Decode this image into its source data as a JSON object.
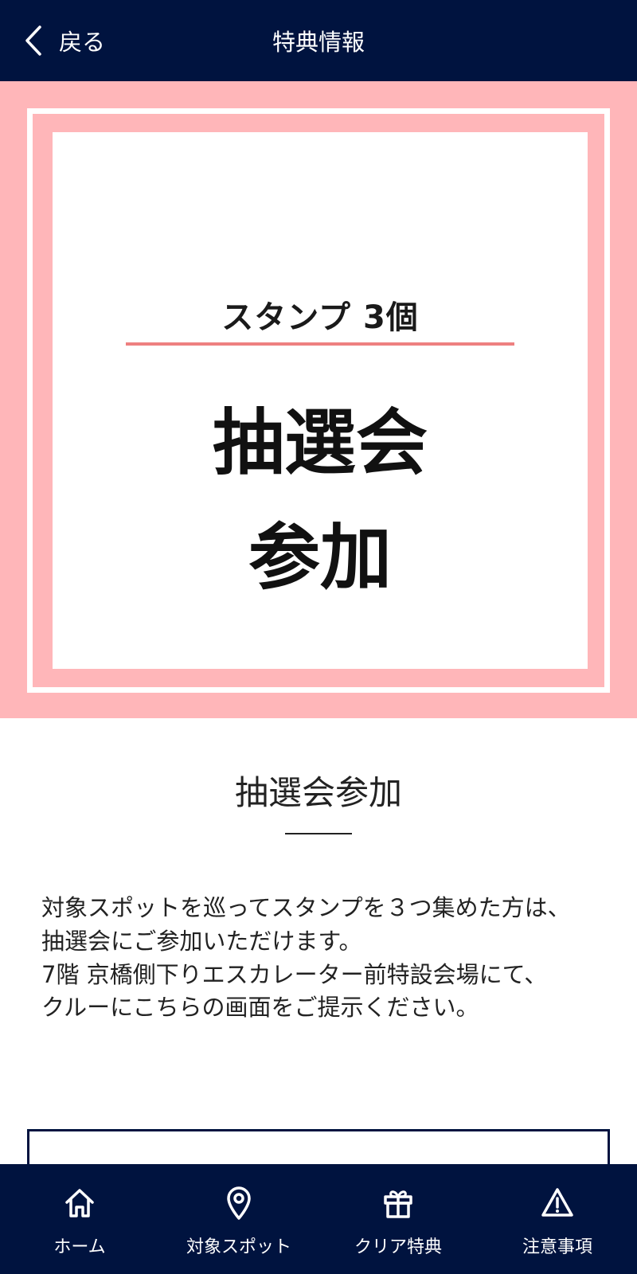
{
  "header": {
    "back_label": "戻る",
    "title": "特典情報"
  },
  "banner": {
    "stamp_count": "スタンプ 3個",
    "line1": "抽選会",
    "line2": "参加"
  },
  "section": {
    "title": "抽選会参加",
    "description": [
      "対象スポットを巡ってスタンプを３つ集めた方は、",
      "抽選会にご参加いただけます。",
      "7階 京橋側下りエスカレーター前特設会場にて、",
      "クルーにこちらの画面をご提示ください。"
    ]
  },
  "bottom_nav": {
    "items": [
      {
        "label": "ホーム",
        "icon": "home-icon"
      },
      {
        "label": "対象スポット",
        "icon": "map-pin-icon"
      },
      {
        "label": "クリア特典",
        "icon": "gift-icon"
      },
      {
        "label": "注意事項",
        "icon": "warning-icon"
      }
    ]
  },
  "colors": {
    "navy": "#00133f",
    "banner_pink": "#ffb6b9",
    "accent_line": "#ee8080"
  }
}
